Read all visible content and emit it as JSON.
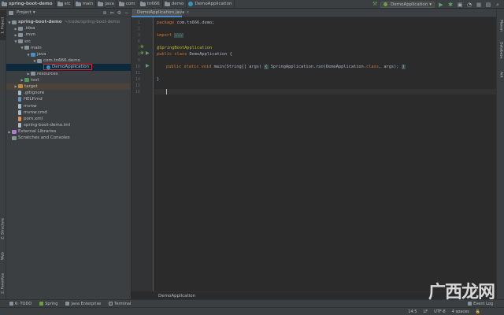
{
  "navbar": {
    "crumbs": [
      "spring-boot-demo",
      "src",
      "main",
      "java",
      "com",
      "tn666",
      "demo",
      "DemoApplication"
    ],
    "run_config": "DemoApplication"
  },
  "project_panel": {
    "title": "Project",
    "tree": [
      {
        "label": "spring-boot-demo",
        "path": "~/code/spring-boot-demo"
      },
      {
        "label": ".idea"
      },
      {
        "label": ".mvn"
      },
      {
        "label": "src"
      },
      {
        "label": "main"
      },
      {
        "label": "java"
      },
      {
        "label": "com.tn666.demo"
      },
      {
        "label": "DemoApplication"
      },
      {
        "label": "resources"
      },
      {
        "label": "test"
      },
      {
        "label": "target"
      },
      {
        "label": ".gitignore"
      },
      {
        "label": "HELP.md"
      },
      {
        "label": "mvnw"
      },
      {
        "label": "mvnw.cmd"
      },
      {
        "label": "pom.xml"
      },
      {
        "label": "spring-boot-demo.iml"
      },
      {
        "label": "External Libraries"
      },
      {
        "label": "Scratches and Consoles"
      }
    ]
  },
  "left_tabs": [
    "1: Project",
    "Z: Structure",
    "Web",
    "2: Favorites"
  ],
  "right_tabs": [
    "Maven",
    "Database",
    "Ant"
  ],
  "editor": {
    "tab_label": "DemoApplication.java",
    "line_numbers": [
      "1",
      "2",
      "3",
      "6",
      "7",
      "8",
      "9",
      "10",
      "11",
      "14",
      "15",
      "16"
    ],
    "code": {
      "l1_kw": "package",
      "l1_rest": " com.tn666.demo;",
      "l3_kw": "import",
      "l3_fold": "...",
      "l7_ann": "@SpringBootApplication",
      "l8_kw": "public class",
      "l8_rest": " DemoApplication {",
      "l10_kw": "public static void",
      "l10_a": " main(String[] args) ",
      "l10_fold1": "{",
      "l10_b": " SpringApplication.",
      "l10_italic": "run",
      "l10_c": "(DemoApplication.",
      "l10_kw2": "class",
      "l10_d": ", args); ",
      "l10_fold2": "}",
      "l15": "}"
    },
    "breadcrumb": "DemoApplication"
  },
  "bottom_tools": [
    "6: TODO",
    "Spring",
    "Java Enterprise",
    "Terminal"
  ],
  "event_log": "Event Log",
  "status": {
    "position": "14:5",
    "line_sep": "LF",
    "encoding": "UTF-8",
    "indent": "4 spaces"
  },
  "watermark": "广西龙网"
}
